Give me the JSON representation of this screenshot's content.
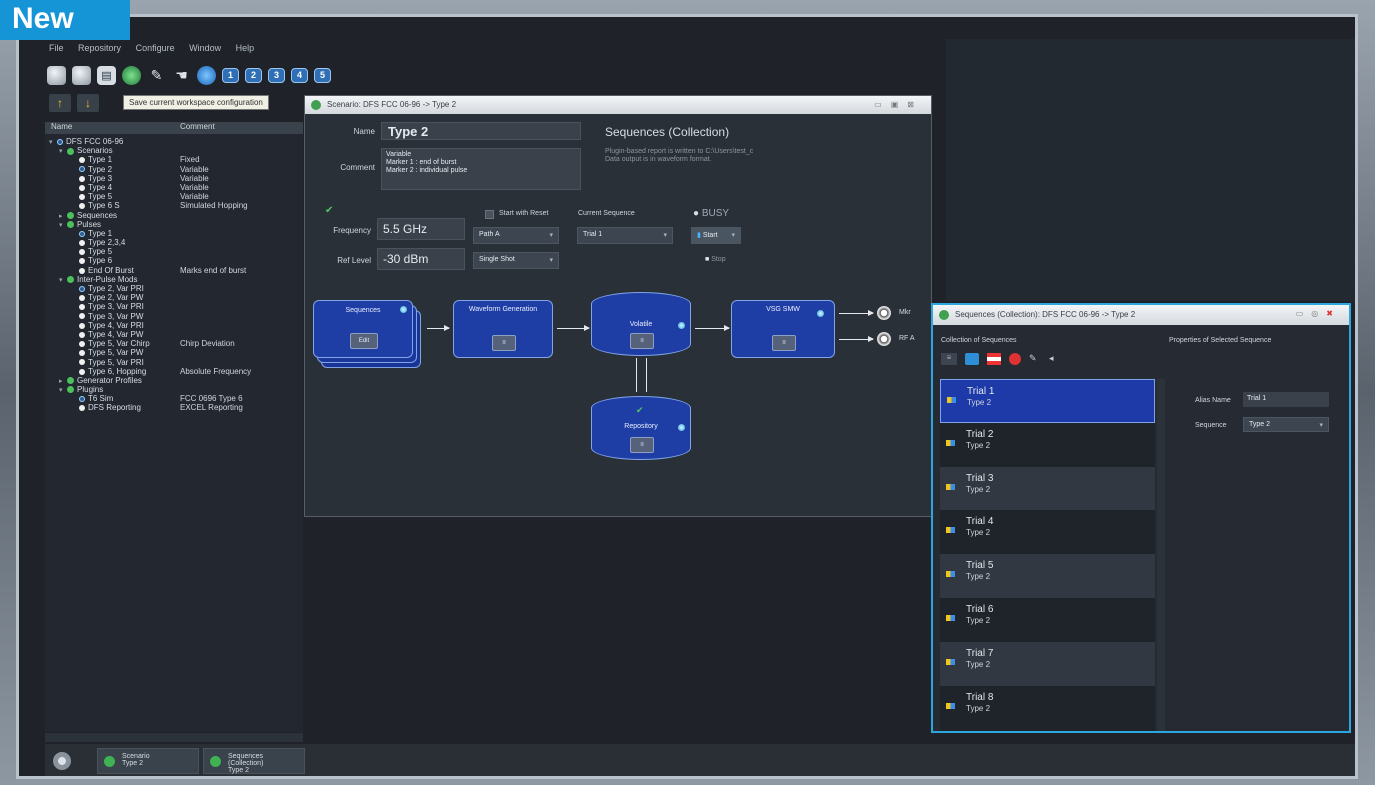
{
  "badge": "New",
  "menu": [
    "File",
    "Repository",
    "Configure",
    "Window",
    "Help"
  ],
  "tooltip": "Save current workspace configuration",
  "toolbar_numbers": [
    "1",
    "2",
    "3",
    "4",
    "5"
  ],
  "tree": {
    "headers": {
      "name": "Name",
      "comment": "Comment"
    },
    "root": "DFS FCC 06-96",
    "scenarios_label": "Scenarios",
    "scenarios": [
      {
        "name": "Type 1",
        "comment": "Fixed"
      },
      {
        "name": "Type 2",
        "comment": "Variable"
      },
      {
        "name": "Type 3",
        "comment": "Variable"
      },
      {
        "name": "Type 4",
        "comment": "Variable"
      },
      {
        "name": "Type 5",
        "comment": "Variable"
      },
      {
        "name": "Type 6 S",
        "comment": "Simulated Hopping"
      }
    ],
    "sequences_label": "Sequences",
    "pulses_label": "Pulses",
    "pulses": [
      {
        "name": "Type 1",
        "comment": ""
      },
      {
        "name": "Type 2,3,4",
        "comment": ""
      },
      {
        "name": "Type 5",
        "comment": ""
      },
      {
        "name": "Type 6",
        "comment": ""
      },
      {
        "name": "End Of Burst",
        "comment": "Marks end of burst"
      }
    ],
    "ipm_label": "Inter-Pulse Mods",
    "ipm": [
      {
        "name": "Type 2, Var PRI",
        "comment": ""
      },
      {
        "name": "Type 2, Var PW",
        "comment": ""
      },
      {
        "name": "Type 3, Var PRI",
        "comment": ""
      },
      {
        "name": "Type 3, Var PW",
        "comment": ""
      },
      {
        "name": "Type 4, Var PRI",
        "comment": ""
      },
      {
        "name": "Type 4, Var PW",
        "comment": ""
      },
      {
        "name": "Type 5, Var Chirp",
        "comment": "Chirp Deviation"
      },
      {
        "name": "Type 5, Var PW",
        "comment": ""
      },
      {
        "name": "Type 5, Var PRI",
        "comment": ""
      },
      {
        "name": "Type 6, Hopping",
        "comment": "Absolute Frequency"
      }
    ],
    "gen_label": "Generator Profiles",
    "plugins_label": "Plugins",
    "plugins": [
      {
        "name": "T6 Sim",
        "comment": "FCC 0696 Type 6"
      },
      {
        "name": "DFS Reporting",
        "comment": "EXCEL Reporting"
      }
    ]
  },
  "scenario": {
    "title": "Scenario: DFS FCC 06-96 -> Type 2",
    "name_label": "Name",
    "name": "Type 2",
    "comment_label": "Comment",
    "comment_lines": [
      "Variable",
      "Marker 1 : end of burst",
      "Marker 2 : individual pulse"
    ],
    "seq_heading": "Sequences (Collection)",
    "info_lines": [
      "Plugin-based report is written to C:\\Users\\test_c",
      "Data output is in waveform format."
    ],
    "freq_label": "Frequency",
    "freq": "5.5 GHz",
    "ref_label": "Ref Level",
    "ref": "-30 dBm",
    "start_reset": "Start with Reset",
    "current_seq_label": "Current Sequence",
    "busy": "BUSY",
    "path": "Path A",
    "current_seq": "Trial 1",
    "start": "Start",
    "mode": "Single Shot",
    "stop": "Stop",
    "block_sequences": "Sequences",
    "block_edit": "Edit",
    "block_waveform": "Waveform Generation",
    "block_volatile": "Volatile",
    "block_vsg": "VSG SMW",
    "block_repository": "Repository",
    "out1": "Mkr",
    "out2": "RF A"
  },
  "seqwin": {
    "title": "Sequences (Collection): DFS FCC 06-96 -> Type 2",
    "collection_label": "Collection of Sequences",
    "props_label": "Properties of Selected Sequence",
    "alias_label": "Alias Name",
    "alias": "Trial 1",
    "sequence_label": "Sequence",
    "sequence": "Type 2",
    "items": [
      {
        "name": "Trial 1",
        "sub": "Type 2"
      },
      {
        "name": "Trial 2",
        "sub": "Type 2"
      },
      {
        "name": "Trial 3",
        "sub": "Type 2"
      },
      {
        "name": "Trial 4",
        "sub": "Type 2"
      },
      {
        "name": "Trial 5",
        "sub": "Type 2"
      },
      {
        "name": "Trial 6",
        "sub": "Type 2"
      },
      {
        "name": "Trial 7",
        "sub": "Type 2"
      },
      {
        "name": "Trial 8",
        "sub": "Type 2"
      }
    ]
  },
  "tasks": [
    {
      "title": "Scenario",
      "sub": "Type 2"
    },
    {
      "title": "Sequences (Collection)",
      "sub": "Type 2"
    }
  ]
}
